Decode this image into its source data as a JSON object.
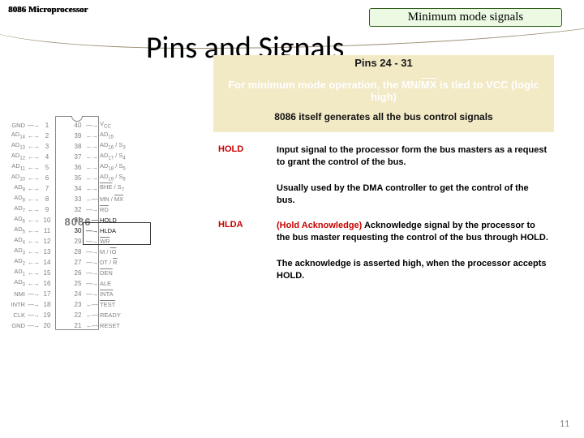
{
  "header": {
    "label": "8086 Microprocessor"
  },
  "mode_box": "Minimum mode signals",
  "page_title": "Pins and Signals",
  "panel": {
    "pins_range": "Pins 24 - 31",
    "line1_pre": "For minimum mode operation, the MN/",
    "line1_bar": "MX",
    "line1_post": " is tied to VCC (logic high)",
    "subline": "8086 itself generates all the bus control signals"
  },
  "signals": [
    {
      "name": "HOLD",
      "paras": [
        "Input signal to the processor form the bus masters as a request to grant the control of the bus.",
        "Usually used by the DMA controller to get the control of the bus."
      ]
    },
    {
      "name": "HLDA",
      "lead_red": "(Hold Acknowledge)",
      "lead_rest": " Acknowledge signal by the processor to the bus master requesting the control of the bus through HOLD.",
      "paras": [
        "The acknowledge is asserted high, when the processor accepts HOLD."
      ]
    }
  ],
  "page_number": "11",
  "chip": {
    "name": "8086",
    "rows": [
      {
        "n": 1,
        "ll": "GND",
        "la": "→",
        "rn": 40,
        "ra": "→",
        "rl": "V_CC"
      },
      {
        "n": 2,
        "ll": "AD_14",
        "la": "↔",
        "rn": 39,
        "ra": "↔",
        "rl": "AD_15"
      },
      {
        "n": 3,
        "ll": "AD_13",
        "la": "↔",
        "rn": 38,
        "ra": "↔",
        "rl": "AD_16 / S_3"
      },
      {
        "n": 4,
        "ll": "AD_12",
        "la": "↔",
        "rn": 37,
        "ra": "↔",
        "rl": "AD_17 / S_4"
      },
      {
        "n": 5,
        "ll": "AD_11",
        "la": "↔",
        "rn": 36,
        "ra": "↔",
        "rl": "AD_18 / S_5"
      },
      {
        "n": 6,
        "ll": "AD_10",
        "la": "↔",
        "rn": 35,
        "ra": "↔",
        "rl": "AD_19 / S_6"
      },
      {
        "n": 7,
        "ll": "AD_9",
        "la": "↔",
        "rn": 34,
        "ra": "↔",
        "rl": "~BHE / S_7"
      },
      {
        "n": 8,
        "ll": "AD_8",
        "la": "↔",
        "rn": 33,
        "ra": "←",
        "rl": "MN / ~MX"
      },
      {
        "n": 9,
        "ll": "AD_7",
        "la": "↔",
        "rn": 32,
        "ra": "→",
        "rl": "~RD"
      },
      {
        "n": 10,
        "ll": "AD_6",
        "la": "↔",
        "rn": 31,
        "ra": "←",
        "rl": "HOLD",
        "hl": true
      },
      {
        "n": 11,
        "ll": "AD_5",
        "la": "↔",
        "rn": 30,
        "ra": "→",
        "rl": "HLDA",
        "hl": true
      },
      {
        "n": 12,
        "ll": "AD_4",
        "la": "↔",
        "rn": 29,
        "ra": "→",
        "rl": "~WR"
      },
      {
        "n": 13,
        "ll": "AD_3",
        "la": "↔",
        "rn": 28,
        "ra": "→",
        "rl": "M / ~IO"
      },
      {
        "n": 14,
        "ll": "AD_2",
        "la": "↔",
        "rn": 27,
        "ra": "→",
        "rl": "DT / ~R"
      },
      {
        "n": 15,
        "ll": "AD_1",
        "la": "↔",
        "rn": 26,
        "ra": "→",
        "rl": "~DEN"
      },
      {
        "n": 16,
        "ll": "AD_0",
        "la": "↔",
        "rn": 25,
        "ra": "→",
        "rl": "ALE"
      },
      {
        "n": 17,
        "ll": "NMI",
        "la": "→",
        "rn": 24,
        "ra": "→",
        "rl": "~INTA"
      },
      {
        "n": 18,
        "ll": "INTR",
        "la": "→",
        "rn": 23,
        "ra": "←",
        "rl": "~TEST"
      },
      {
        "n": 19,
        "ll": "CLK",
        "la": "→",
        "rn": 22,
        "ra": "←",
        "rl": "READY"
      },
      {
        "n": 20,
        "ll": "GND",
        "la": "→",
        "rn": 21,
        "ra": "←",
        "rl": "RESET"
      }
    ]
  }
}
